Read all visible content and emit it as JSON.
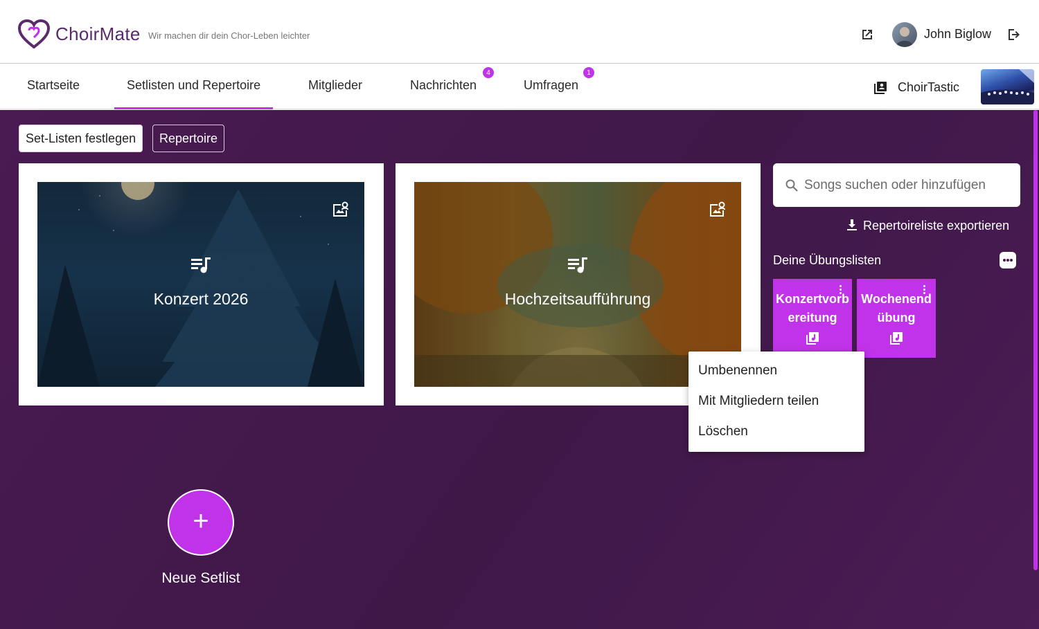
{
  "header": {
    "brand": "ChoirMate",
    "tagline": "Wir machen dir dein Chor-Leben leichter",
    "user_name": "John Biglow"
  },
  "nav": {
    "tabs": [
      {
        "label": "Startseite"
      },
      {
        "label": "Setlisten und Repertoire",
        "active": true
      },
      {
        "label": "Mitglieder"
      },
      {
        "label": "Nachrichten",
        "badge": "4"
      },
      {
        "label": "Umfragen",
        "badge": "1"
      }
    ],
    "choir_name": "ChoirTastic"
  },
  "main": {
    "buttons": {
      "setlists": "Set-Listen festlegen",
      "repertoire": "Repertoire"
    },
    "setlists": [
      {
        "title": "Konzert 2026"
      },
      {
        "title": "Hochzeitsaufführung"
      }
    ],
    "search": {
      "placeholder": "Songs suchen oder hinzufügen"
    },
    "export_label": "Repertoireliste exportieren",
    "practice_heading": "Deine Übungslisten",
    "practice_lists": [
      {
        "label": "Konzertvorbereitung"
      },
      {
        "label": "Wochenendübung"
      }
    ],
    "context_menu": [
      "Umbenennen",
      "Mit Mitgliedern teilen",
      "Löschen"
    ],
    "new_setlist_label": "Neue Setlist",
    "fab_symbol": "+"
  },
  "colors": {
    "accent": "#c033e8",
    "background": "#4a1a52",
    "brand": "#5a2a6b"
  }
}
